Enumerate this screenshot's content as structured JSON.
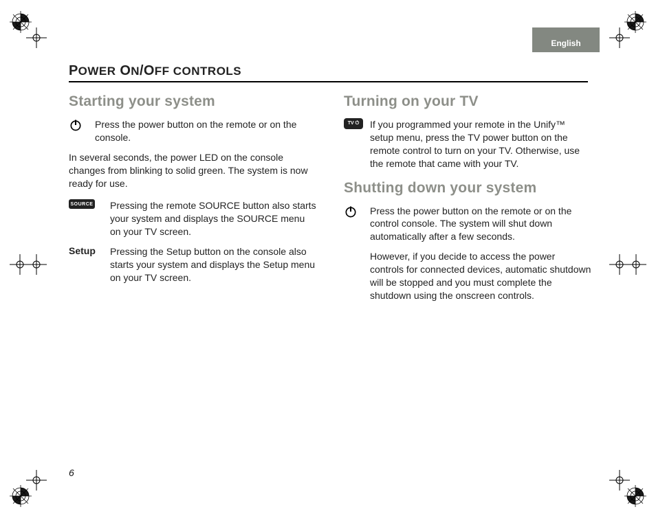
{
  "language_tab": "English",
  "heading": {
    "p": "P",
    "ower": "OWER",
    "sp": " ",
    "o": "O",
    "n": "N",
    "slash": "/",
    "o2": "O",
    "ff": "FF",
    "ctrls": " CONTROLS"
  },
  "page_number": "6",
  "left": {
    "section1_title": "Starting your system",
    "row_power": "Press the power button on the remote or on the console.",
    "para1": "In several seconds, the power LED on the console changes from blinking to solid green. The system is now ready for use.",
    "source_icon_label": "SOURCE",
    "row_source": "Pressing the remote SOURCE button also starts your system and displays the SOURCE menu on your TV screen.",
    "setup_label": "Setup",
    "row_setup": "Pressing the Setup button on the console also starts your system and displays the Setup menu on your TV screen."
  },
  "right": {
    "section1_title": "Turning on your TV",
    "tv_icon_label": "TV ⏻",
    "row_tv": "If you programmed your remote in the Unify™ setup menu, press the TV power button on the remote control to turn on your TV. Otherwise, use the remote that came with your TV.",
    "section2_title": "Shutting down your system",
    "row_power": "Press the power button on the remote or on the control console. The system will shut down automatically after a few seconds.",
    "para2": "However, if you decide to access the power controls for connected devices, automatic shutdown will be stopped and you must complete the shutdown using the onscreen controls."
  }
}
